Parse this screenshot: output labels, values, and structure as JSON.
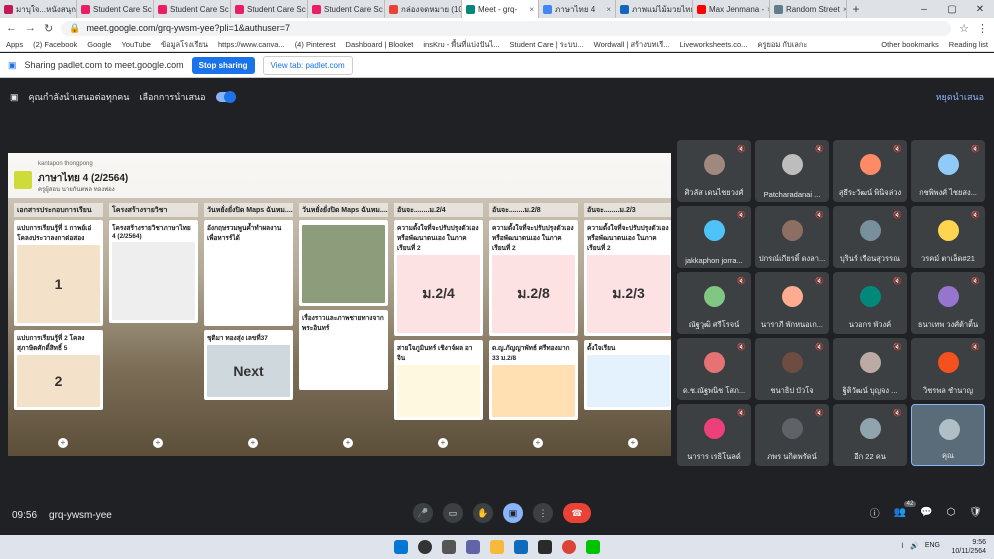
{
  "browser": {
    "tabs": [
      {
        "label": "มาบุใจ...หนังสนุกป่า",
        "color": "#c2185b"
      },
      {
        "label": "Student Care Sc",
        "color": "#e91e63"
      },
      {
        "label": "Student Care Sc",
        "color": "#e91e63"
      },
      {
        "label": "Student Care Sc",
        "color": "#e91e63"
      },
      {
        "label": "Student Care Sc",
        "color": "#e91e63"
      },
      {
        "label": "กล่องจดหมาย (10)",
        "color": "#ea4335"
      },
      {
        "label": "Meet - grq-",
        "color": "#00897b",
        "active": true
      },
      {
        "label": "ภาษาไทย 4",
        "color": "#4285f4"
      },
      {
        "label": "ภาพแม่ไม้มวยไทย",
        "color": "#1565c0"
      },
      {
        "label": "Max Jenmana -",
        "color": "#ff0000"
      },
      {
        "label": "Random Street",
        "color": "#607d8b"
      }
    ],
    "new_tab": "+",
    "url": "meet.google.com/grq-ywsm-yee?pli=1&authuser=7",
    "bookmarks": [
      "Apps",
      "(2) Facebook",
      "Google",
      "YouTube",
      "ข้อมูลโรงเรียน",
      "https://www.canva...",
      "(4) Pinterest",
      "Dashboard | Blooket",
      "insKru - พื้นที่แบ่งปันไ...",
      "Student Care | ระบบ...",
      "Wordwall | สร้างบทเรี...",
      "Liveworksheets.co...",
      "ครูยอม กับเลกะ"
    ],
    "bookmarks_right": [
      "Other bookmarks",
      "Reading list"
    ]
  },
  "sharing_bar": {
    "text": "Sharing padlet.com to meet.google.com",
    "stop_label": "Stop sharing",
    "view_label": "View tab: padlet.com"
  },
  "presenting_bar": {
    "text": "คุณกำลังนำเสนอต่อทุกคน",
    "option": "เลือกการนำเสนอ",
    "stop": "หยุดนำเสนอ"
  },
  "padlet": {
    "author": "kantapon thongpong",
    "title": "ภาษาไทย 4 (2/2564)",
    "subtitle": "ครูผู้สอน นายกันตพล ทองพ่อง",
    "columns": [
      {
        "head": "เอกสารประกอบการเรียน",
        "cards": [
          {
            "title": "แบ่บการเรียนรู้ที่ 1 กาพย์เอ่ โคลงประวาลงกาต่อสอง",
            "thumb": "#f4e1c9",
            "big": "1"
          },
          {
            "title": "แบ่บการเรียนรู้ที่ 2 โคลงสุภาษิตศักดิ์สิทธิ์ 5",
            "thumb": "#f4e1c9",
            "big": "2"
          }
        ]
      },
      {
        "head": "โครงสร้างรายวิชา",
        "cards": [
          {
            "title": "โครงสร้างรายวิชาภาษาไทย 4 (2/2564)",
            "thumb": "#eeeeee",
            "big": ""
          }
        ]
      },
      {
        "head": "วันหยั่งยั่งปิด Maps ฉันหม......(2/11)",
        "cards": [
          {
            "title": "อังกฤษรวมพูนค้ำทำผลงานเพื่อหารร์ได้",
            "thumb": "#ffffff",
            "big": ""
          },
          {
            "title": "ชุติมา ทองสุ่ง เลขที่37",
            "thumb": "#cfd8dc",
            "big": "Next"
          }
        ]
      },
      {
        "head": "วันหยั่งยั่งปิด Maps ฉันหม......(2/4)",
        "cards": [
          {
            "title": "",
            "thumb": "#8d9c7a",
            "big": ""
          },
          {
            "title": "เรื่องราวและภาพชายทางจากพระอินทร์",
            "thumb": "#ffffff",
            "big": ""
          }
        ]
      },
      {
        "head": "อันจะ........ม.2/4",
        "cards": [
          {
            "title": "ความตั้งใจที่จะปรับปรุงตัวเองหรือพัฒนาตนเอง ในภาคเรียนที่ 2",
            "thumb": "#fde2e4",
            "big": "ม.2/4"
          },
          {
            "title": "สายใจภูมินทร์ เชิงาจ์ผล อาจิน",
            "thumb": "#fff8e1",
            "big": ""
          }
        ]
      },
      {
        "head": "อันจะ........ม.2/8",
        "cards": [
          {
            "title": "ความตั้งใจที่จะปรับปรุงตัวเองหรือพัฒนาตนเอง ในภาคเรียนที่ 2",
            "thumb": "#fde2e4",
            "big": "ม.2/8"
          },
          {
            "title": "ด.ญ.ภัญญาพัทธ์ ศรีทองมาก 33 ม.2/8",
            "thumb": "#ffe0b2",
            "big": ""
          }
        ]
      },
      {
        "head": "อันจะ........ม.2/3",
        "cards": [
          {
            "title": "ความตั้งใจที่จะปรับปรุงตัวเองหรือพัฒนาตนเอง ในภาคเรียนที่ 2",
            "thumb": "#fde2e4",
            "big": "ม.2/3"
          },
          {
            "title": "ตั้งใจเรียน",
            "thumb": "#e3f2fd",
            "big": ""
          }
        ]
      }
    ]
  },
  "participants": [
    {
      "name": "ศิวลัส เดนไชยวงศ์",
      "color": "#a1887f"
    },
    {
      "name": "Patcharadanai ...",
      "color": "#bdbdbd"
    },
    {
      "name": "สุธีระวัฒน์ พินิจล่วง",
      "color": "#ff8a65"
    },
    {
      "name": "กชพิพงศ์ ไชยสง...",
      "color": "#90caf9"
    },
    {
      "name": "jakkaphon jorra...",
      "color": "#4fc3f7"
    },
    {
      "name": "ปกรณ์เกียรติ์ ดงลา...",
      "color": "#8d6e63"
    },
    {
      "name": "บุรินร์ เรือนสุวรรณ",
      "color": "#78909c"
    },
    {
      "name": "วรคม์ ตาเล็ด#21",
      "color": "#ffd54f"
    },
    {
      "name": "ณัฐวุฒิ ศรีโรจน์",
      "color": "#81c784"
    },
    {
      "name": "นาราภี พักหนอเก...",
      "color": "#ffab91"
    },
    {
      "name": "นวอกร พัวงค์",
      "color": "#00897b"
    },
    {
      "name": "ธนาเทพ วงศ์ต้าติ้น",
      "color": "#9575cd"
    },
    {
      "name": "ด.ช.ณัฐพนิช โสภ...",
      "color": "#e57373"
    },
    {
      "name": "ชนาธิป บัวโจ",
      "color": "#6d4c41"
    },
    {
      "name": "ฐิติวัฒน์ บุญจง ...",
      "color": "#bcaaa4"
    },
    {
      "name": "วิชรพล ชำนาญ",
      "color": "#f4511e"
    },
    {
      "name": "นาราร เรธิโนลด์",
      "color": "#ec407a"
    },
    {
      "name": "ภพร นกิตพรัดน์",
      "color": "#5f6368"
    },
    {
      "name": "อีก 22 คน",
      "color": "#90a4ae"
    },
    {
      "name": "คุณ",
      "color": "#b0bec5",
      "me": true
    }
  ],
  "meeting": {
    "time": "09:56",
    "code": "grq-ywsm-yee",
    "people_count": "42"
  },
  "taskbar": {
    "clock": "9:56",
    "date": "10/11/2564",
    "lang": "ENG"
  }
}
